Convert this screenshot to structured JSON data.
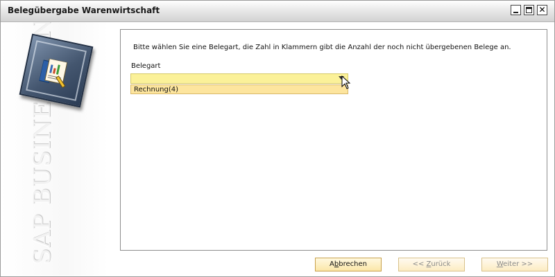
{
  "window": {
    "title": "Belegübergabe Warenwirtschaft"
  },
  "branding": {
    "vertical_text": "SAP BUSINESS ONE"
  },
  "content": {
    "instruction": "Bitte wählen Sie eine Belegart, die Zahl in Klammern gibt die Anzahl der noch nicht übergebenen Belege an.",
    "field_label": "Belegart",
    "combo_value": "",
    "dropdown_items": [
      "Rechnung(4)"
    ]
  },
  "buttons": {
    "cancel": {
      "pre": "A",
      "u": "b",
      "post": "brechen"
    },
    "back": {
      "pre": "<< ",
      "u": "Z",
      "post": "urück"
    },
    "next": {
      "pre": "",
      "u": "W",
      "post": "eiter >>"
    }
  },
  "colors": {
    "combo_bg": "#fbf199",
    "dropdown_bg": "#fde59e",
    "button_border": "#c8a04a"
  }
}
